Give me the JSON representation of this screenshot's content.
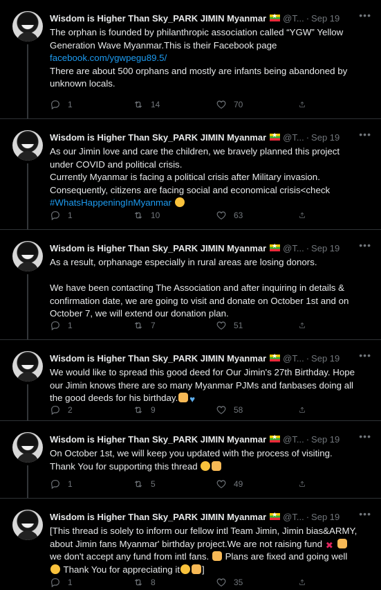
{
  "author": {
    "name": "Wisdom is Higher Than Sky_PARK JIMIN Myanmar"
  },
  "tweets": [
    {
      "handle": "@T...",
      "date": "Sep 19",
      "lines": [
        "The orphan is founded by philanthropic association called “YGW” Yellow",
        "Generation Wave Myanmar.This is their Facebook page"
      ],
      "link": "facebook.com/ygwpegu89.5/",
      "lines2": [
        "There are about 500 orphans and mostly are infants being abandoned by",
        "unknown locals."
      ],
      "replies": "1",
      "retweets": "14",
      "likes": "70"
    },
    {
      "handle": "@T...",
      "date": "Sep 19",
      "lines": [
        "As our Jimin love and care the children, we bravely planned this project",
        "under COVID and political crisis.",
        "Currently Myanmar is facing a political crisis after Military invasion.",
        "Consequently, citizens are facing social and economical crisis<check"
      ],
      "hashtag": "#WhatsHappeningInMyanmar",
      "replies": "1",
      "retweets": "10",
      "likes": "63"
    },
    {
      "handle": "@T...",
      "date": "Sep 19",
      "lines": [
        "As a result, orphanage especially in rural areas are losing donors.",
        "",
        "We have been contacting The Association and after inquiring in details &",
        "confirmation date, we are going to visit and donate on October 1st and on",
        "October 7, we will extend our donation plan."
      ],
      "replies": "1",
      "retweets": "7",
      "likes": "51"
    },
    {
      "handle": "@T...",
      "date": "Sep 19",
      "lines": [
        "We would like to spread this good deed for Our Jimin's 27th Birthday. Hope",
        "our Jimin knows there are so many Myanmar PJMs and fanbases doing all",
        "the good deeds for his birthday."
      ],
      "replies": "2",
      "retweets": "9",
      "likes": "58"
    },
    {
      "handle": "@T...",
      "date": "Sep 19",
      "lines": [
        "On October 1st, we will keep you updated with the process of visiting.",
        "Thank You for supporting this thread"
      ],
      "replies": "1",
      "retweets": "5",
      "likes": "49"
    },
    {
      "handle": "@T...",
      "date": "Sep 19",
      "lines": [
        "[This thread is solely to inform our fellow intl Team Jimin, Jimin bias&ARMY,",
        "about Jimin fans Myanmar' birthday project.We are not raising fund",
        "we don't accept any fund from intl fans.",
        "Plans are fixed and going well",
        "Thank You for appreciating it",
        "]"
      ],
      "replies": "1",
      "retweets": "8",
      "likes": "35"
    }
  ],
  "icons": {
    "reply": "reply-icon",
    "retweet": "retweet-icon",
    "like": "heart-icon",
    "share": "share-icon",
    "more": "more-icon",
    "flag": "myanmar-flag-icon"
  }
}
